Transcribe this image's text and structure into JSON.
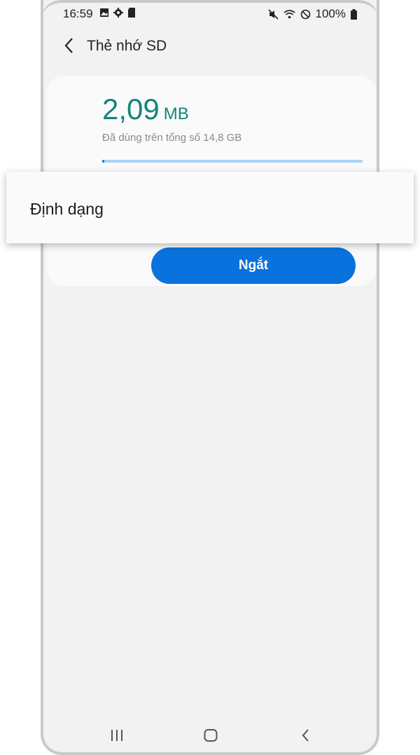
{
  "status_bar": {
    "time": "16:59",
    "battery": "100%",
    "icons": [
      "image-icon",
      "gear-icon",
      "sd-card-icon",
      "mute-icon",
      "wifi-icon",
      "do-not-disturb-icon",
      "battery-icon"
    ]
  },
  "header": {
    "title": "Thẻ nhớ SD",
    "back_icon": "chevron-left-icon"
  },
  "storage": {
    "used_value": "2,09",
    "used_unit": "MB",
    "subtitle": "Đã dùng trên tổng số 14,8 GB",
    "progress_fraction": 0.005
  },
  "menu": {
    "items": [
      "Định dạng"
    ]
  },
  "actions": {
    "unmount_label": "Ngắt"
  },
  "colors": {
    "accent": "#14857a",
    "button": "#0a72dd",
    "progress_track": "#a9d3f5",
    "progress_fill": "#1a73e8"
  },
  "nav_bar": {
    "icons": [
      "recents-icon",
      "home-icon",
      "back-icon"
    ]
  }
}
